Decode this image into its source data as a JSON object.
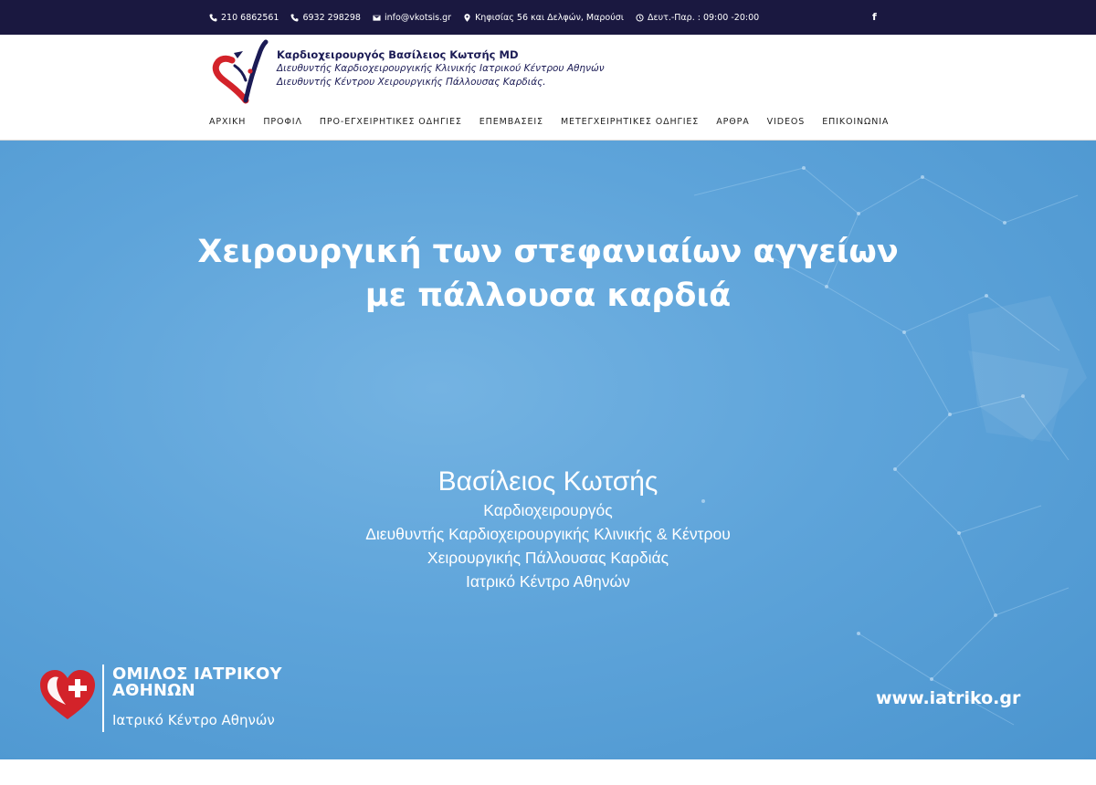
{
  "topbar": {
    "phone1": "210 6862561",
    "phone2": "6932 298298",
    "email": "info@vkotsis.gr",
    "address": "Κηφισίας 56 και Δελφών, Μαρούσι",
    "hours": "Δευτ.-Παρ. : 09:00 -20:00",
    "facebook": "f"
  },
  "brand": {
    "title": "Καρδιοχειρουργός Βασίλειος Κωτσής MD",
    "line1": "Διευθυντής Καρδιοχειρουργικής Κλινικής Ιατρικού Κέντρου Αθηνών",
    "line2": "Διευθυντής Κέντρου Χειρουργικής Πάλλουσας Καρδιάς."
  },
  "nav": {
    "items": [
      "ΑΡΧΙΚΗ",
      "ΠΡΟΦΙΛ",
      "ΠΡΟ-ΕΓΧΕΙΡΗΤΙΚΕΣ ΟΔΗΓΙΕΣ",
      "ΕΠΕΜΒΑΣΕΙΣ",
      "ΜΕΤΕΓΧΕΙΡΗΤΙΚΕΣ ΟΔΗΓΙΕΣ",
      "ΑΡΘΡΑ",
      "VIDEOS",
      "ΕΠΙΚΟΙΝΩΝΙΑ"
    ]
  },
  "hero": {
    "title_line1": "Χειρουργική των στεφανιαίων αγγείων",
    "title_line2": "με πάλλουσα καρδιά",
    "doctor_name": "Βασίλειος Κωτσής",
    "doctor_lines": [
      "Καρδιοχειρουργός",
      "Διευθυντής Καρδιοχειρουργικής Κλινικής & Κέντρου",
      "Χειρουργικής Πάλλουσας Καρδιάς",
      "Ιατρικό Κέντρο Αθηνών"
    ],
    "group_name_line1": "ΟΜΙΛΟΣ ΙΑΤΡΙΚΟΥ",
    "group_name_line2": "ΑΘΗΝΩΝ",
    "group_subtitle": "Ιατρικό Κέντρο Αθηνών",
    "website": "www.iatriko.gr"
  },
  "colors": {
    "topbar_bg": "#1a1840",
    "brand_text": "#1b1b55",
    "hero_bg": "#5ea4da",
    "logo_red": "#d3232a"
  },
  "icons": {
    "phone": "phone-icon",
    "mobile": "mobile-icon",
    "email": "envelope-icon",
    "address": "map-marker-icon",
    "hours": "clock-icon",
    "social": "facebook-icon"
  }
}
